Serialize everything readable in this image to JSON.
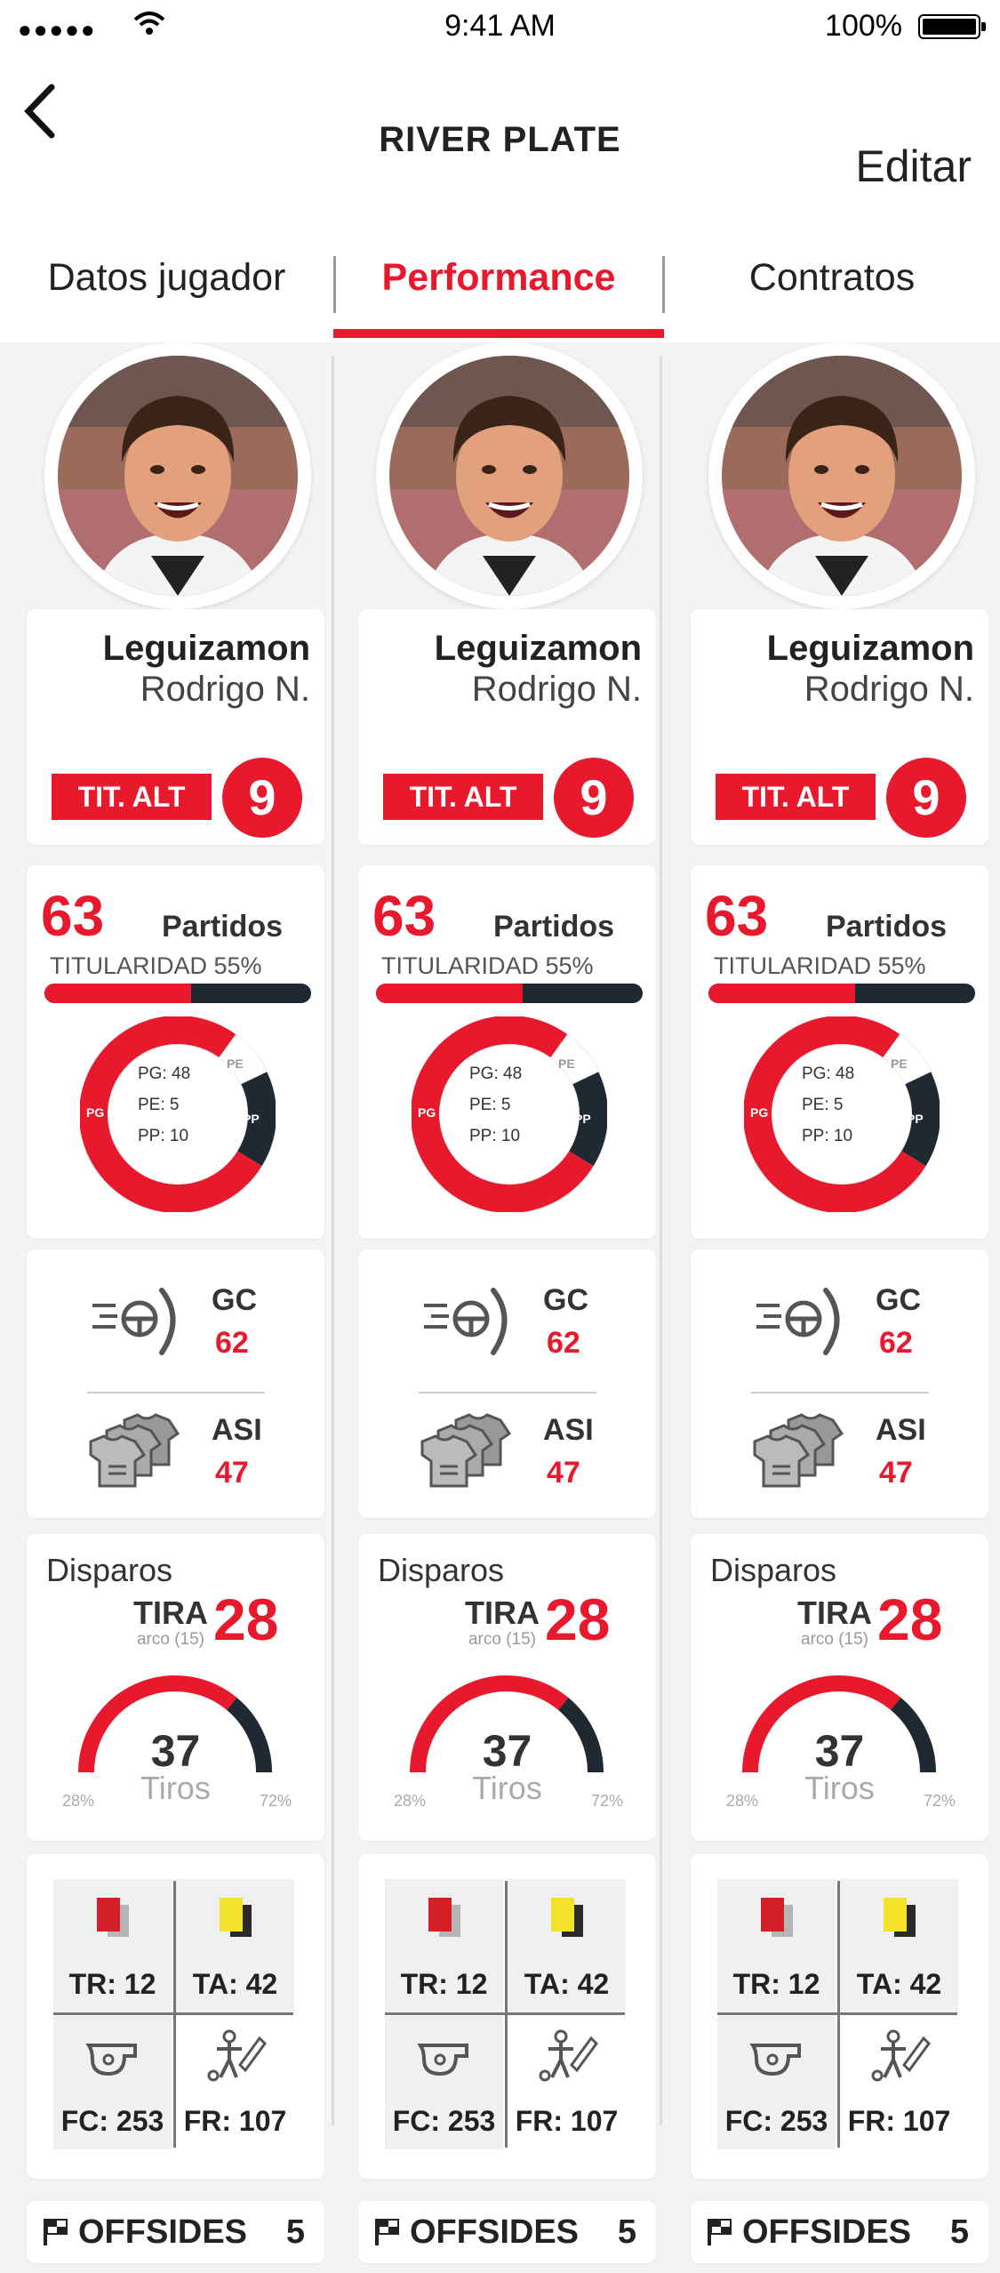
{
  "status_bar": {
    "time": "9:41 AM",
    "battery": "100%"
  },
  "header": {
    "title": "RIVER PLATE",
    "edit_label": "Editar"
  },
  "tabs": [
    {
      "label": "Datos jugador",
      "active": false
    },
    {
      "label": "Performance",
      "active": true
    },
    {
      "label": "Contratos",
      "active": false
    }
  ],
  "colors": {
    "accent": "#e8192c",
    "dark": "#202831"
  },
  "players": [
    {
      "last_name": "Leguizamon",
      "first_name": "Rodrigo N.",
      "role": "TIT. ALT",
      "number": "9",
      "matches": {
        "value": "63",
        "label": "Partidos",
        "starter_label": "TITULARIDAD 55%",
        "starter_pct": 55
      },
      "results": {
        "pg_label": "PG",
        "pe_label": "PE",
        "pp_label": "PP",
        "pg": 48,
        "pe": 5,
        "pp": 10,
        "pg_text": "PG: 48",
        "pe_text": "PE: 5",
        "pp_text": "PP: 10"
      },
      "goals": {
        "label": "GC",
        "value": "62"
      },
      "assists": {
        "label": "ASI",
        "value": "47"
      },
      "shots": {
        "title": "Disparos",
        "on_target_label": "TIRA",
        "on_target_sub": "arco (15)",
        "on_target_value": "28",
        "total_value": "37",
        "total_label": "Tiros",
        "left_pct": "28%",
        "right_pct": "72%"
      },
      "cards": {
        "red": "TR: 12",
        "yellow": "TA: 42",
        "fouls_committed": "FC: 253",
        "fouls_received": "FR: 107"
      },
      "offsides": {
        "label": "OFFSIDES",
        "value": "5"
      }
    },
    {
      "last_name": "Leguizamon",
      "first_name": "Rodrigo N.",
      "role": "TIT. ALT",
      "number": "9",
      "matches": {
        "value": "63",
        "label": "Partidos",
        "starter_label": "TITULARIDAD 55%",
        "starter_pct": 55
      },
      "results": {
        "pg_label": "PG",
        "pe_label": "PE",
        "pp_label": "PP",
        "pg": 48,
        "pe": 5,
        "pp": 10,
        "pg_text": "PG: 48",
        "pe_text": "PE: 5",
        "pp_text": "PP: 10"
      },
      "goals": {
        "label": "GC",
        "value": "62"
      },
      "assists": {
        "label": "ASI",
        "value": "47"
      },
      "shots": {
        "title": "Disparos",
        "on_target_label": "TIRA",
        "on_target_sub": "arco (15)",
        "on_target_value": "28",
        "total_value": "37",
        "total_label": "Tiros",
        "left_pct": "28%",
        "right_pct": "72%"
      },
      "cards": {
        "red": "TR: 12",
        "yellow": "TA: 42",
        "fouls_committed": "FC: 253",
        "fouls_received": "FR: 107"
      },
      "offsides": {
        "label": "OFFSIDES",
        "value": "5"
      }
    },
    {
      "last_name": "Leguizamon",
      "first_name": "Rodrigo N.",
      "role": "TIT. ALT",
      "number": "9",
      "matches": {
        "value": "63",
        "label": "Partidos",
        "starter_label": "TITULARIDAD 55%",
        "starter_pct": 55
      },
      "results": {
        "pg_label": "PG",
        "pe_label": "PE",
        "pp_label": "PP",
        "pg": 48,
        "pe": 5,
        "pp": 10,
        "pg_text": "PG: 48",
        "pe_text": "PE: 5",
        "pp_text": "PP: 10"
      },
      "goals": {
        "label": "GC",
        "value": "62"
      },
      "assists": {
        "label": "ASI",
        "value": "47"
      },
      "shots": {
        "title": "Disparos",
        "on_target_label": "TIRA",
        "on_target_sub": "arco (15)",
        "on_target_value": "28",
        "total_value": "37",
        "total_label": "Tiros",
        "left_pct": "28%",
        "right_pct": "72%"
      },
      "cards": {
        "red": "TR: 12",
        "yellow": "TA: 42",
        "fouls_committed": "FC: 253",
        "fouls_received": "FR: 107"
      },
      "offsides": {
        "label": "OFFSIDES",
        "value": "5"
      }
    }
  ]
}
